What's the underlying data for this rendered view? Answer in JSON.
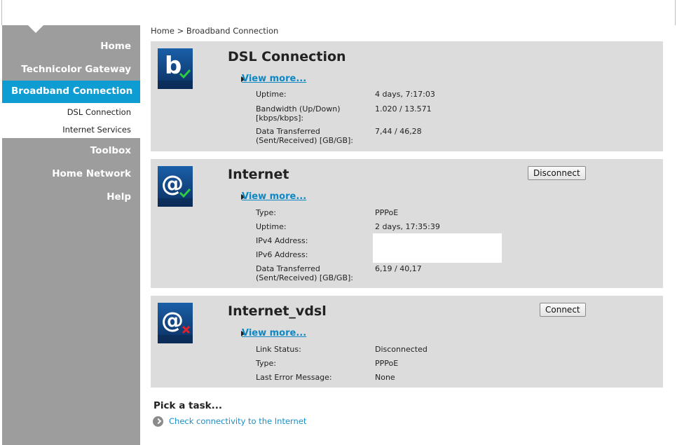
{
  "breadcrumb": "Home > Broadband Connection",
  "nav": {
    "home": "Home",
    "gateway": "Technicolor Gateway",
    "broadband": "Broadband Connection",
    "sub_dsl": "DSL Connection",
    "sub_internet": "Internet Services",
    "toolbox": "Toolbox",
    "home_network": "Home Network",
    "help": "Help"
  },
  "dsl": {
    "title": "DSL Connection",
    "view_more": "View more...",
    "uptime_label": "Uptime:",
    "uptime": "4 days, 7:17:03",
    "bandwidth_label": "Bandwidth (Up/Down) [kbps/kbps]:",
    "bandwidth": "1.020 / 13.571",
    "data_label": "Data Transferred (Sent/Received) [GB/GB]:",
    "data": "7,44 / 46,28"
  },
  "internet": {
    "title": "Internet",
    "button": "Disconnect",
    "view_more": "View more...",
    "type_label": "Type:",
    "type": "PPPoE",
    "uptime_label": "Uptime:",
    "uptime": "2 days, 17:35:39",
    "ipv4_label": "IPv4 Address:",
    "ipv6_label": "IPv6 Address:",
    "data_label": "Data Transferred (Sent/Received) [GB/GB]:",
    "data": "6,19 / 40,17"
  },
  "vdsl": {
    "title": "Internet_vdsl",
    "button": "Connect",
    "view_more": "View more...",
    "link_label": "Link Status:",
    "link": "Disconnected",
    "type_label": "Type:",
    "type": "PPPoE",
    "error_label": "Last Error Message:",
    "error": "None"
  },
  "tasks": {
    "title": "Pick a task...",
    "link": "Check connectivity to the Internet"
  },
  "colors": {
    "accent": "#0e9dd3",
    "sidebar": "#9d9d9d",
    "card": "#dcdcdc",
    "ok": "#2ecc40",
    "error": "#e0202a"
  }
}
